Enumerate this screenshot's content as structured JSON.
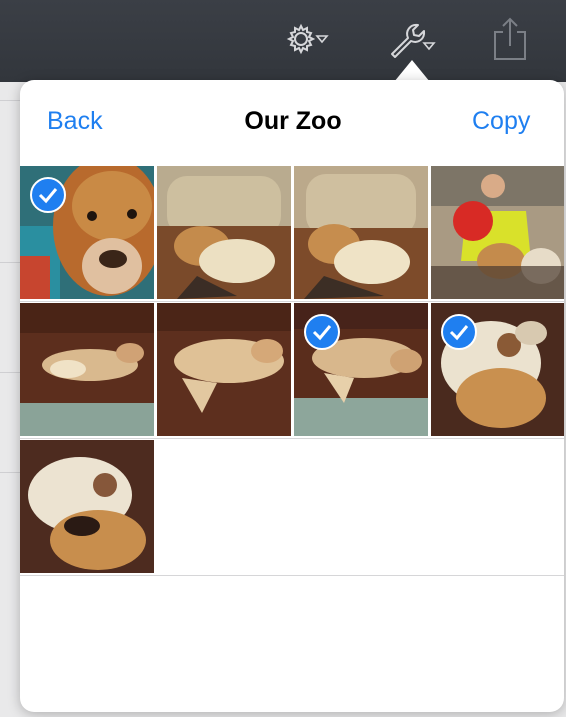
{
  "toolbar": {
    "icons": [
      "gear-menu-icon",
      "wrench-menu-icon",
      "share-icon"
    ],
    "active": "wrench-menu-icon"
  },
  "popover": {
    "back_label": "Back",
    "title": "Our Zoo",
    "copy_label": "Copy"
  },
  "photos": [
    {
      "subject": "dog face close-up on blanket",
      "selected": true
    },
    {
      "subject": "dog and cat on armchair",
      "selected": false
    },
    {
      "subject": "dog and cat on armchair",
      "selected": false
    },
    {
      "subject": "child with red balloon and dogs",
      "selected": false
    },
    {
      "subject": "dog lying on brown couch",
      "selected": false
    },
    {
      "subject": "dog sleeping on brown couch",
      "selected": false
    },
    {
      "subject": "dog stretched on couch",
      "selected": true
    },
    {
      "subject": "dogs snuggled together",
      "selected": true
    },
    {
      "subject": "dogs snuggled together",
      "selected": false
    }
  ],
  "colors": {
    "accent": "#1f7ff0",
    "toolbar": "#383c42",
    "check_fill": "#1f7ff0"
  }
}
